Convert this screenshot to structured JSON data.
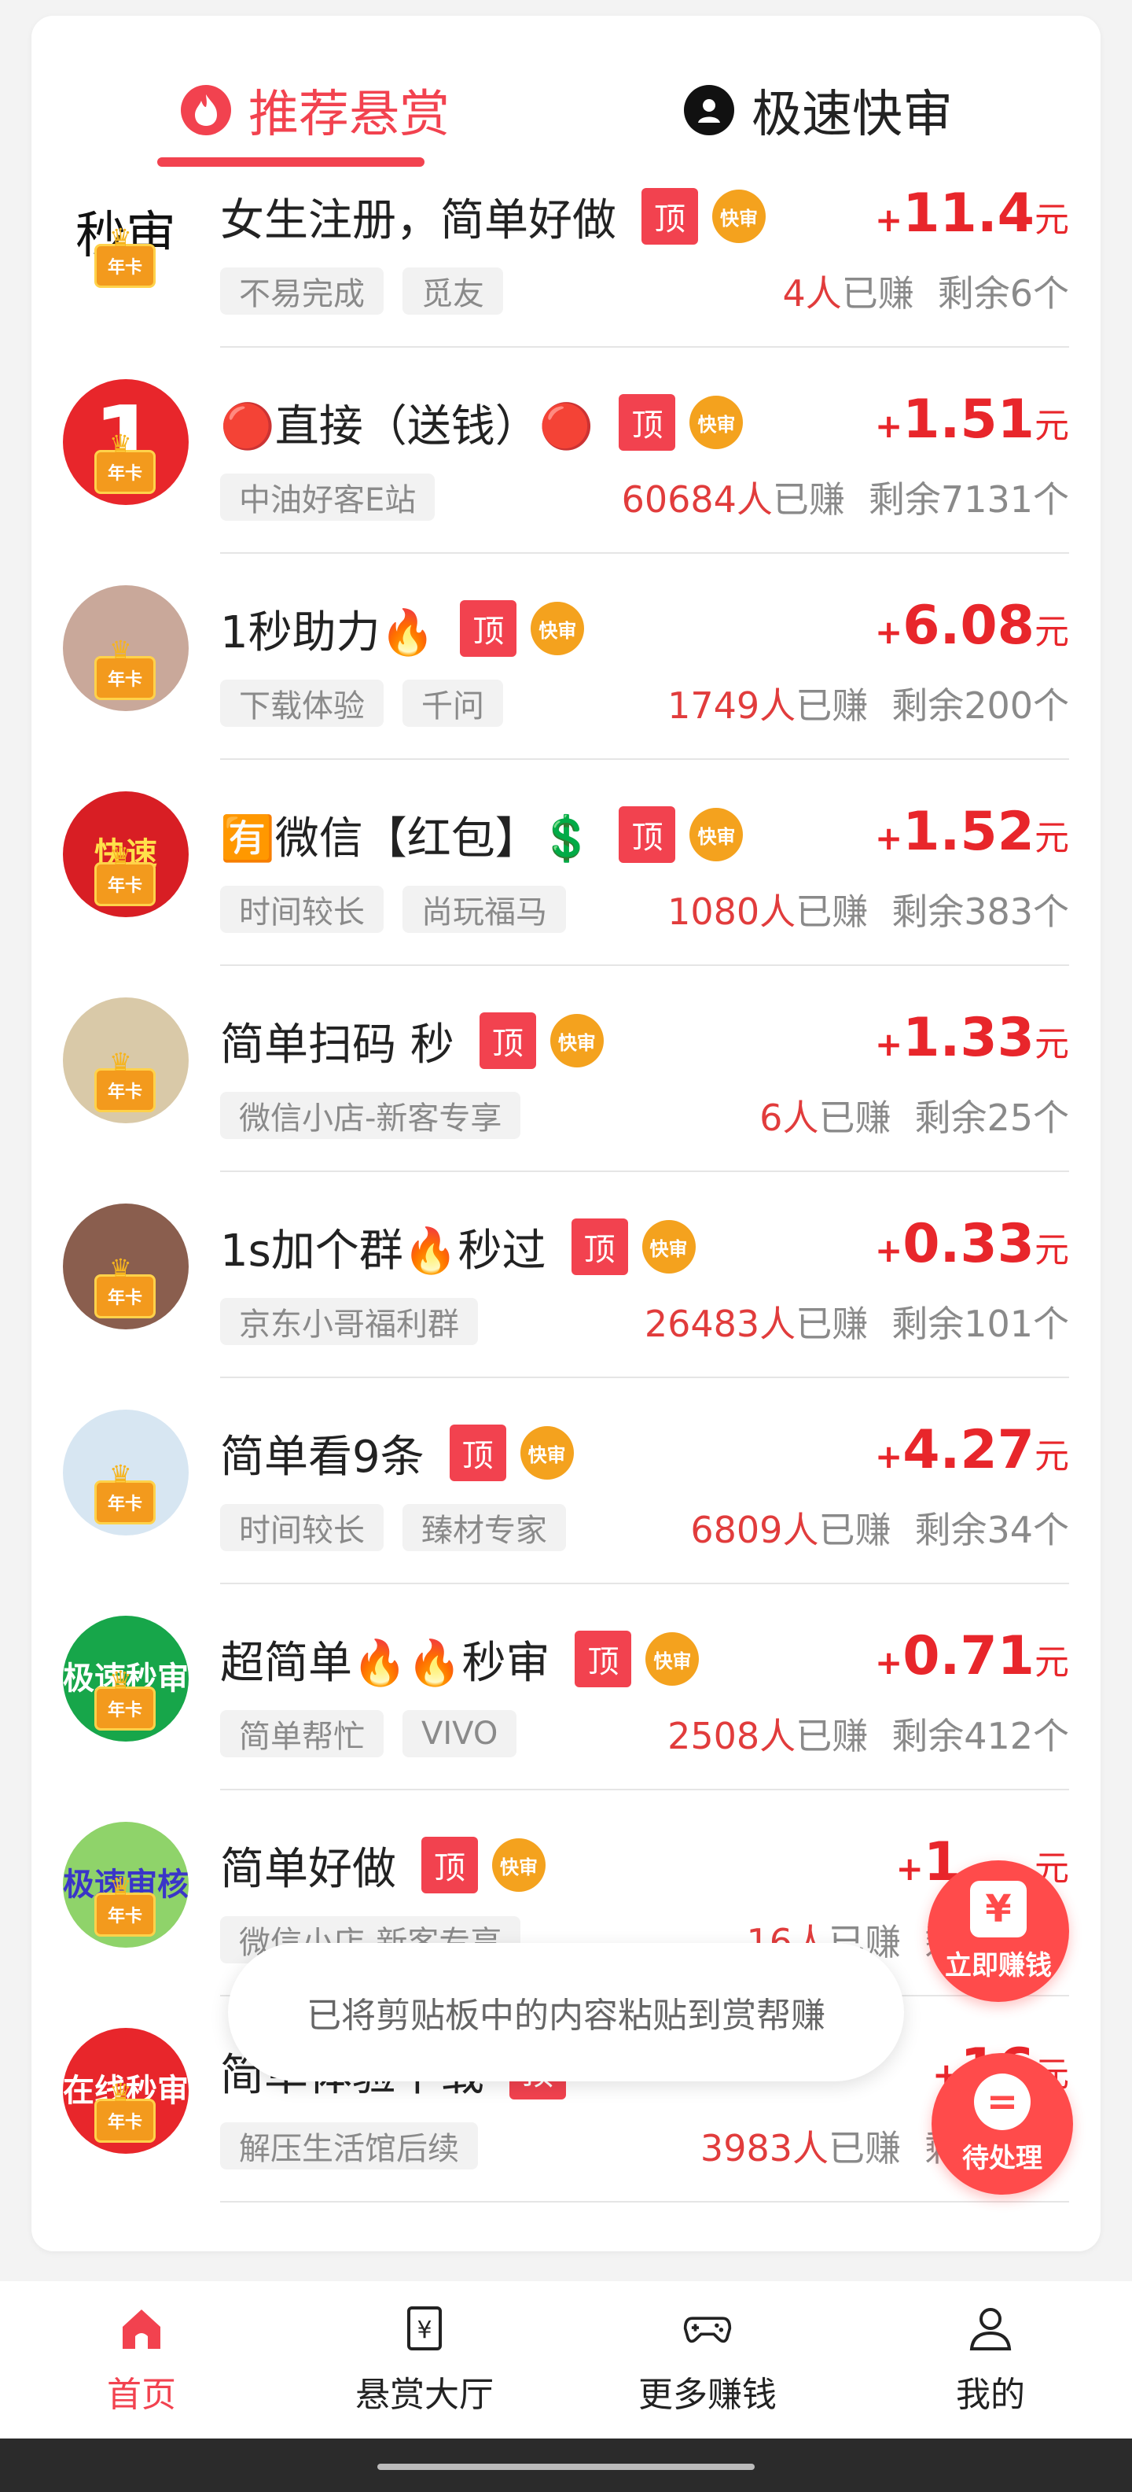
{
  "tabs": {
    "recommended": "推荐悬赏",
    "fast_review": "极速快审"
  },
  "tasks": [
    {
      "title": "女生注册，简单好做",
      "top_badge": "顶",
      "fast_badge": "快审",
      "plus": "+",
      "amount": "11.4",
      "unit": "元",
      "tags": [
        "不易完成",
        "觅友"
      ],
      "earned_count": "4人",
      "earned_label": "已赚",
      "remaining": "剩余6个",
      "avatar_text": "秒审",
      "avatar_color": "#ffffff",
      "avatar_text_color": "#111111"
    },
    {
      "title": "🔴直接（送钱）🔴",
      "top_badge": "顶",
      "fast_badge": "快审",
      "plus": "+",
      "amount": "1.51",
      "unit": "元",
      "tags": [
        "中油好客E站"
      ],
      "earned_count": "60684人",
      "earned_label": "已赚",
      "remaining": "剩余7131个",
      "avatar_text": "1",
      "avatar_color": "#e8262b",
      "avatar_text_color": "#ffffff"
    },
    {
      "title": "1秒助力🔥",
      "top_badge": "顶",
      "fast_badge": "快审",
      "plus": "+",
      "amount": "6.08",
      "unit": "元",
      "tags": [
        "下载体验",
        "千问"
      ],
      "earned_count": "1749人",
      "earned_label": "已赚",
      "remaining": "剩余200个",
      "avatar_text": "",
      "avatar_color": "#c9a89a",
      "avatar_text_color": "#ffffff"
    },
    {
      "title": "🈶微信【红包】💲",
      "top_badge": "顶",
      "fast_badge": "快审",
      "plus": "+",
      "amount": "1.52",
      "unit": "元",
      "tags": [
        "时间较长",
        "尚玩福马"
      ],
      "earned_count": "1080人",
      "earned_label": "已赚",
      "remaining": "剩余383个",
      "avatar_text": "快速",
      "avatar_color": "#d81e24",
      "avatar_text_color": "#ffe14a"
    },
    {
      "title": "简单扫码 秒",
      "top_badge": "顶",
      "fast_badge": "快审",
      "plus": "+",
      "amount": "1.33",
      "unit": "元",
      "tags": [
        "微信小店-新客专享"
      ],
      "earned_count": "6人",
      "earned_label": "已赚",
      "remaining": "剩余25个",
      "avatar_text": "",
      "avatar_color": "#d9c9a8",
      "avatar_text_color": "#ffffff"
    },
    {
      "title": "1s加个群🔥秒过",
      "top_badge": "顶",
      "fast_badge": "快审",
      "plus": "+",
      "amount": "0.33",
      "unit": "元",
      "tags": [
        "京东小哥福利群"
      ],
      "earned_count": "26483人",
      "earned_label": "已赚",
      "remaining": "剩余101个",
      "avatar_text": "",
      "avatar_color": "#8a5e4e",
      "avatar_text_color": "#ffffff"
    },
    {
      "title": "简单看9条",
      "top_badge": "顶",
      "fast_badge": "快审",
      "plus": "+",
      "amount": "4.27",
      "unit": "元",
      "tags": [
        "时间较长",
        "臻材专家"
      ],
      "earned_count": "6809人",
      "earned_label": "已赚",
      "remaining": "剩余34个",
      "avatar_text": "",
      "avatar_color": "#d7e6f2",
      "avatar_text_color": "#ffffff"
    },
    {
      "title": "超简单🔥🔥秒审",
      "top_badge": "顶",
      "fast_badge": "快审",
      "plus": "+",
      "amount": "0.71",
      "unit": "元",
      "tags": [
        "简单帮忙",
        "VIVO"
      ],
      "earned_count": "2508人",
      "earned_label": "已赚",
      "remaining": "剩余412个",
      "avatar_text": "极速秒审",
      "avatar_color": "#17a64a",
      "avatar_text_color": "#ffffff"
    },
    {
      "title": "简单好做",
      "top_badge": "顶",
      "fast_badge": "快审",
      "plus": "+",
      "amount": "1.__",
      "unit": "元",
      "tags": [
        "微信小店-新客专享"
      ],
      "earned_count": "16人",
      "earned_label": "已赚",
      "remaining": "剩余__个",
      "avatar_text": "极速审核",
      "avatar_color": "#8fd36a",
      "avatar_text_color": "#3a35c8"
    },
    {
      "title": "简单体验下载",
      "top_badge": "顶",
      "fast_badge": "",
      "plus": "+",
      "amount": "16",
      "unit": "元",
      "tags": [
        "解压生活馆后续"
      ],
      "earned_count": "3983人",
      "earned_label": "已赚",
      "remaining": "剩余__个",
      "avatar_text": "在线秒审",
      "avatar_color": "#e8262b",
      "avatar_text_color": "#ffffff"
    }
  ],
  "year_card_label": "年卡",
  "toast": "已将剪贴板中的内容粘贴到赏帮赚",
  "floating": {
    "earn_now": "立即赚钱",
    "earn_icon": "¥",
    "pending": "待处理",
    "pending_icon": "="
  },
  "nav": [
    {
      "label": "首页",
      "icon": "home-icon",
      "active": true
    },
    {
      "label": "悬赏大厅",
      "icon": "reward-hall-icon",
      "active": false
    },
    {
      "label": "更多赚钱",
      "icon": "gamepad-icon",
      "active": false
    },
    {
      "label": "我的",
      "icon": "profile-icon",
      "active": false
    }
  ],
  "colors": {
    "accent": "#f2424f",
    "amount": "#e8262b",
    "fast_badge": "#f4a21e"
  }
}
